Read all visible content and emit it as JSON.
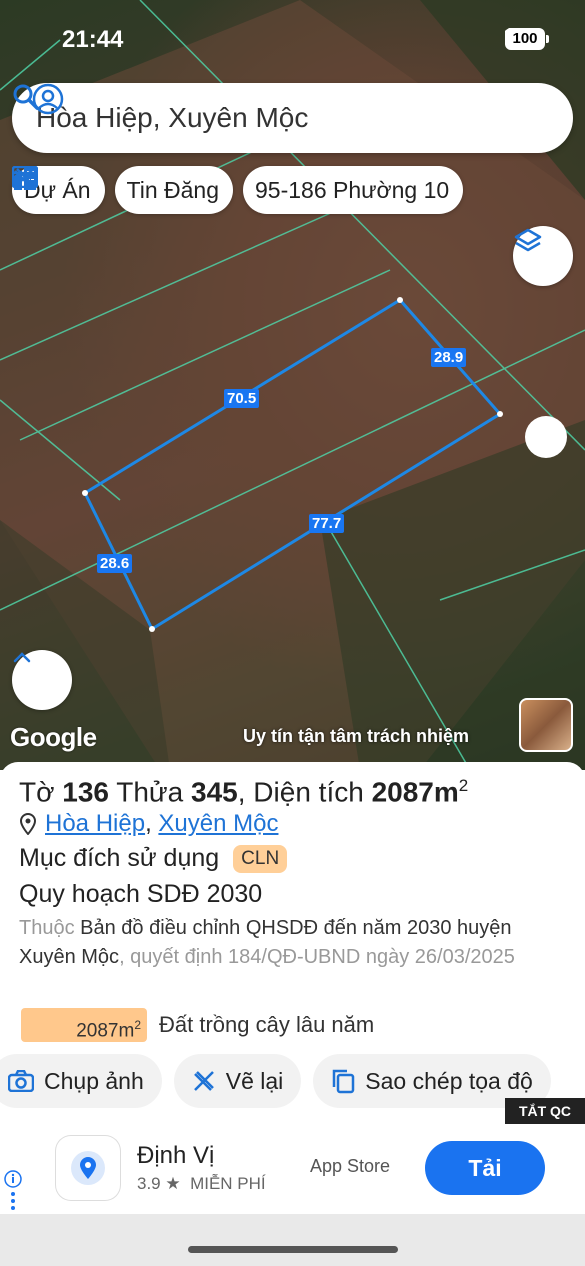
{
  "status_bar": {
    "time": "21:44",
    "battery": "100"
  },
  "search": {
    "query": "Hòa Hiệp, Xuyên Mộc"
  },
  "chips": [
    {
      "label": "Dự Án",
      "icon": "building-icon"
    },
    {
      "label": "Tin Đăng",
      "icon": "listing-icon"
    },
    {
      "label": "95-186 Phường 10",
      "icon": "ruler-cross-icon"
    }
  ],
  "map": {
    "measurements": {
      "top": "70.5",
      "right": "28.9",
      "bottom": "77.7",
      "left": "28.6"
    },
    "google_label": "Google",
    "slogan": "Uy tín tận tâm trách nhiệm",
    "parcel_color": "#1e88e5"
  },
  "sheet": {
    "title_prefix": "Tờ",
    "sheet_no": "136",
    "parcel_word": "Thửa",
    "parcel_no": "345",
    "area_label": ", Diện tích",
    "area_value": "2087m",
    "area_unit_sup": "2",
    "location_commune": "Hòa Hiệp",
    "location_sep": ",",
    "location_district": "Xuyên Mộc",
    "purpose_label": "Mục đích sử dụng",
    "purpose_code": "CLN",
    "plan_title": "Quy hoạch SDĐ 2030",
    "desc_prefix": "Thuộc ",
    "desc_main": "Bản đồ điều chỉnh QHSDĐ đến năm 2030 huyện Xuyên Mộc",
    "desc_suffix": ", quyết định 184/QĐ-UBND ngày 26/03/2025",
    "area_bar_value": "2087m",
    "area_bar_sup": "2",
    "land_type": "Đất trồng cây lâu năm",
    "accent_color": "#ffc88c"
  },
  "actions": [
    {
      "label": "Chụp ảnh",
      "icon": "camera-icon"
    },
    {
      "label": "Vẽ lại",
      "icon": "ruler-cross-icon"
    },
    {
      "label": "Sao chép tọa độ",
      "icon": "copy-icon"
    }
  ],
  "ad": {
    "close_label": "TẮT QC",
    "app_name": "Định Vị",
    "rating": "3.9 ★",
    "price": "MIỄN PHÍ",
    "store": "App Store",
    "install_label": "Tải"
  }
}
